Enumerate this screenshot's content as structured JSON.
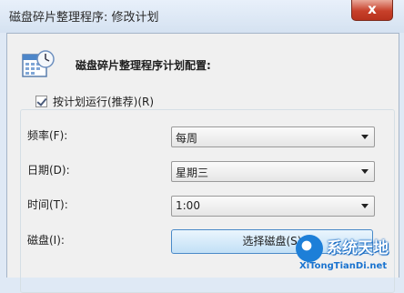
{
  "window": {
    "title": "磁盘碎片整理程序: 修改计划",
    "close_glyph": "x"
  },
  "header": {
    "text": "磁盘碎片整理程序计划配置:"
  },
  "schedule": {
    "run_on_schedule_label": "按计划运行(推荐)(R)",
    "run_on_schedule_checked": true,
    "frequency": {
      "label": "频率(F):",
      "value": "每周"
    },
    "day": {
      "label": "日期(D):",
      "value": "星期三"
    },
    "time": {
      "label": "时间(T):",
      "value": "1:00"
    },
    "disks": {
      "label": "磁盘(I):",
      "button_label": "选择磁盘(S)"
    }
  },
  "watermark": {
    "title": "系统天地",
    "url": "XiTongTianDi.net"
  },
  "icons": [
    "schedule-calendar-icon",
    "checkbox-checked-icon",
    "chevron-down-icon",
    "close-icon"
  ]
}
